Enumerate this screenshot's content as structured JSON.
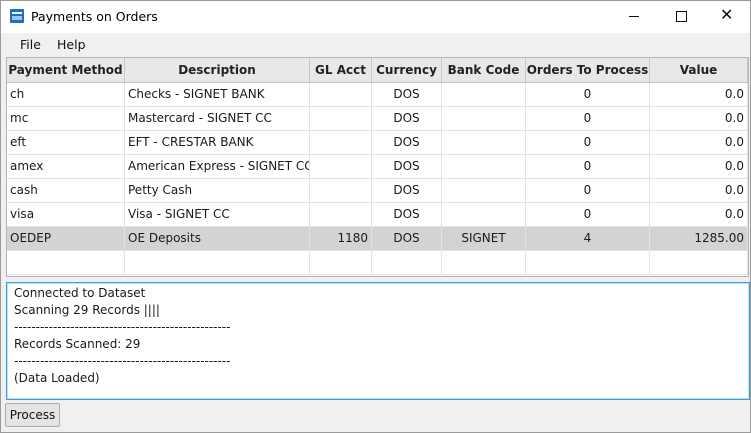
{
  "window": {
    "title": "Payments on Orders",
    "close_glyph": "✕"
  },
  "menu": {
    "file": "File",
    "help": "Help"
  },
  "table": {
    "columns": [
      "Payment Method",
      "Description",
      "GL Acct",
      "Currency",
      "Bank Code",
      "Orders To Process",
      "Value"
    ],
    "rows": [
      [
        "ch",
        "Checks - SIGNET BANK",
        "",
        "DOS",
        "",
        "0",
        "0.0"
      ],
      [
        "mc",
        "Mastercard - SIGNET CC",
        "",
        "DOS",
        "",
        "0",
        "0.0"
      ],
      [
        "eft",
        "EFT - CRESTAR BANK",
        "",
        "DOS",
        "",
        "0",
        "0.0"
      ],
      [
        "amex",
        "American Express - SIGNET CC",
        "",
        "DOS",
        "",
        "0",
        "0.0"
      ],
      [
        "cash",
        "Petty Cash",
        "",
        "DOS",
        "",
        "0",
        "0.0"
      ],
      [
        "visa",
        "Visa - SIGNET CC",
        "",
        "DOS",
        "",
        "0",
        "0.0"
      ],
      [
        "OEDEP",
        "OE Deposits",
        "1180",
        "DOS",
        "SIGNET",
        "4",
        "1285.00"
      ],
      [
        "",
        "",
        "",
        "",
        "",
        "",
        ""
      ]
    ],
    "selected_row": 6
  },
  "log": {
    "lines": [
      "Connected to Dataset",
      "Scanning 29 Records ||||",
      "--------------------------------------------------",
      "Records Scanned: 29",
      "--------------------------------------------------",
      "(Data Loaded)"
    ]
  },
  "actions": {
    "process_label": "Process"
  },
  "colors": {
    "selected_row": "#d3d3d3",
    "focus_border": "#3a9fd6",
    "app_icon": "#1f6fc0"
  },
  "icons": {
    "app": "payments-app-icon",
    "minimize": "minimize-icon",
    "maximize": "maximize-icon",
    "close": "close-icon"
  }
}
